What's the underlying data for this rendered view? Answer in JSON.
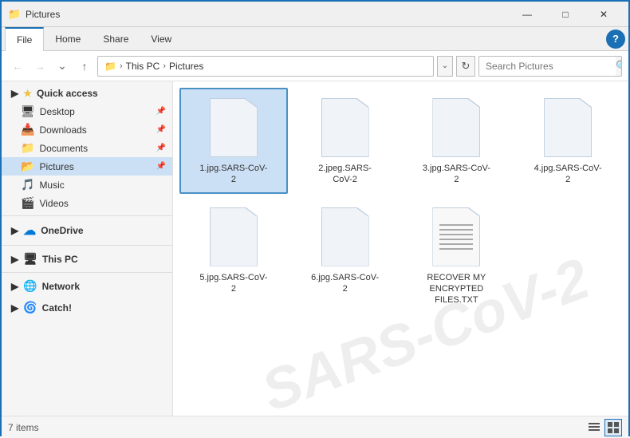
{
  "titleBar": {
    "title": "Pictures",
    "icon": "📁",
    "controls": {
      "minimize": "—",
      "maximize": "□",
      "close": "✕"
    }
  },
  "ribbon": {
    "tabs": [
      "File",
      "Home",
      "Share",
      "View"
    ],
    "activeTab": "File",
    "helpBtn": "?"
  },
  "addressBar": {
    "back": "←",
    "forward": "→",
    "dropdown": "∨",
    "up": "↑",
    "pathParts": [
      "This PC",
      "Pictures"
    ],
    "addressDropdown": "∨",
    "refresh": "↻",
    "search": {
      "placeholder": "Search Pictures",
      "icon": "🔍"
    }
  },
  "sidebar": {
    "sections": [
      {
        "id": "quick-access",
        "label": "Quick access",
        "items": [
          {
            "id": "desktop",
            "label": "Desktop",
            "icon": "🖥",
            "pinned": true
          },
          {
            "id": "downloads",
            "label": "Downloads",
            "icon": "📥",
            "pinned": true
          },
          {
            "id": "documents",
            "label": "Documents",
            "icon": "📁",
            "pinned": true
          },
          {
            "id": "pictures",
            "label": "Pictures",
            "icon": "📂",
            "pinned": true,
            "active": true
          },
          {
            "id": "music",
            "label": "Music",
            "icon": "🎵",
            "pinned": false
          },
          {
            "id": "videos",
            "label": "Videos",
            "icon": "🎬",
            "pinned": false
          }
        ]
      },
      {
        "id": "onedrive",
        "label": "OneDrive",
        "items": []
      },
      {
        "id": "this-pc",
        "label": "This PC",
        "items": []
      },
      {
        "id": "network",
        "label": "Network",
        "items": []
      },
      {
        "id": "catch",
        "label": "Catch!",
        "items": []
      }
    ]
  },
  "files": [
    {
      "id": "file1",
      "name": "1.jpg.SARS-CoV-2",
      "type": "doc",
      "selected": true
    },
    {
      "id": "file2",
      "name": "2.jpeg.SARS-CoV-2",
      "type": "doc",
      "selected": false
    },
    {
      "id": "file3",
      "name": "3.jpg.SARS-CoV-2",
      "type": "doc",
      "selected": false
    },
    {
      "id": "file4",
      "name": "4.jpg.SARS-CoV-2",
      "type": "doc",
      "selected": false
    },
    {
      "id": "file5",
      "name": "5.jpg.SARS-CoV-2",
      "type": "doc",
      "selected": false
    },
    {
      "id": "file6",
      "name": "6.jpg.SARS-CoV-2",
      "type": "doc",
      "selected": false
    },
    {
      "id": "file7",
      "name": "RECOVER MY ENCRYPTED FILES.TXT",
      "type": "text",
      "selected": false
    }
  ],
  "statusBar": {
    "count": "7 items",
    "viewList": "≡",
    "viewLarge": "⊞"
  }
}
